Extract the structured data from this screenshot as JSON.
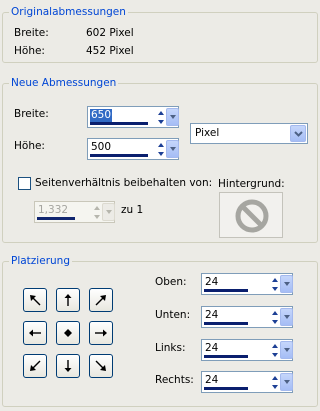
{
  "original": {
    "title": "Originalabmessungen",
    "width_label": "Breite:",
    "width_value": "602 Pixel",
    "height_label": "Höhe:",
    "height_value": "452 Pixel"
  },
  "new_dims": {
    "title": "Neue Abmessungen",
    "width_label": "Breite:",
    "width_value": "650",
    "height_label": "Höhe:",
    "height_value": "500",
    "unit_selected": "Pixel",
    "aspect_label": "Seitenverhältnis beibehalten von:",
    "aspect_checked": false,
    "aspect_value": "1,332",
    "aspect_suffix": "zu 1",
    "background_label": "Hintergrund:"
  },
  "placement": {
    "title": "Platzierung",
    "buttons": [
      "top-left",
      "top",
      "top-right",
      "left",
      "center",
      "right",
      "bottom-left",
      "bottom",
      "bottom-right"
    ],
    "top_label": "Oben:",
    "top_value": "24",
    "bottom_label": "Unten:",
    "bottom_value": "24",
    "left_label": "Links:",
    "left_value": "24",
    "right_label": "Rechts:",
    "right_value": "24"
  },
  "icons": {
    "spin_up": "triangle-up",
    "spin_down": "triangle-down",
    "dropdown": "chevron-down",
    "no_color": "circle-slash",
    "placement": [
      "arrow-up-left",
      "arrow-up",
      "arrow-up-right",
      "arrow-left",
      "diamond",
      "arrow-right",
      "arrow-down-left",
      "arrow-down",
      "arrow-down-right"
    ]
  },
  "colors": {
    "group_title": "#0046d5",
    "window_bg": "#ecebe6",
    "field_border": "#7f9db9",
    "selection": "#316ac5",
    "level_bar": "#0a1f6e"
  }
}
